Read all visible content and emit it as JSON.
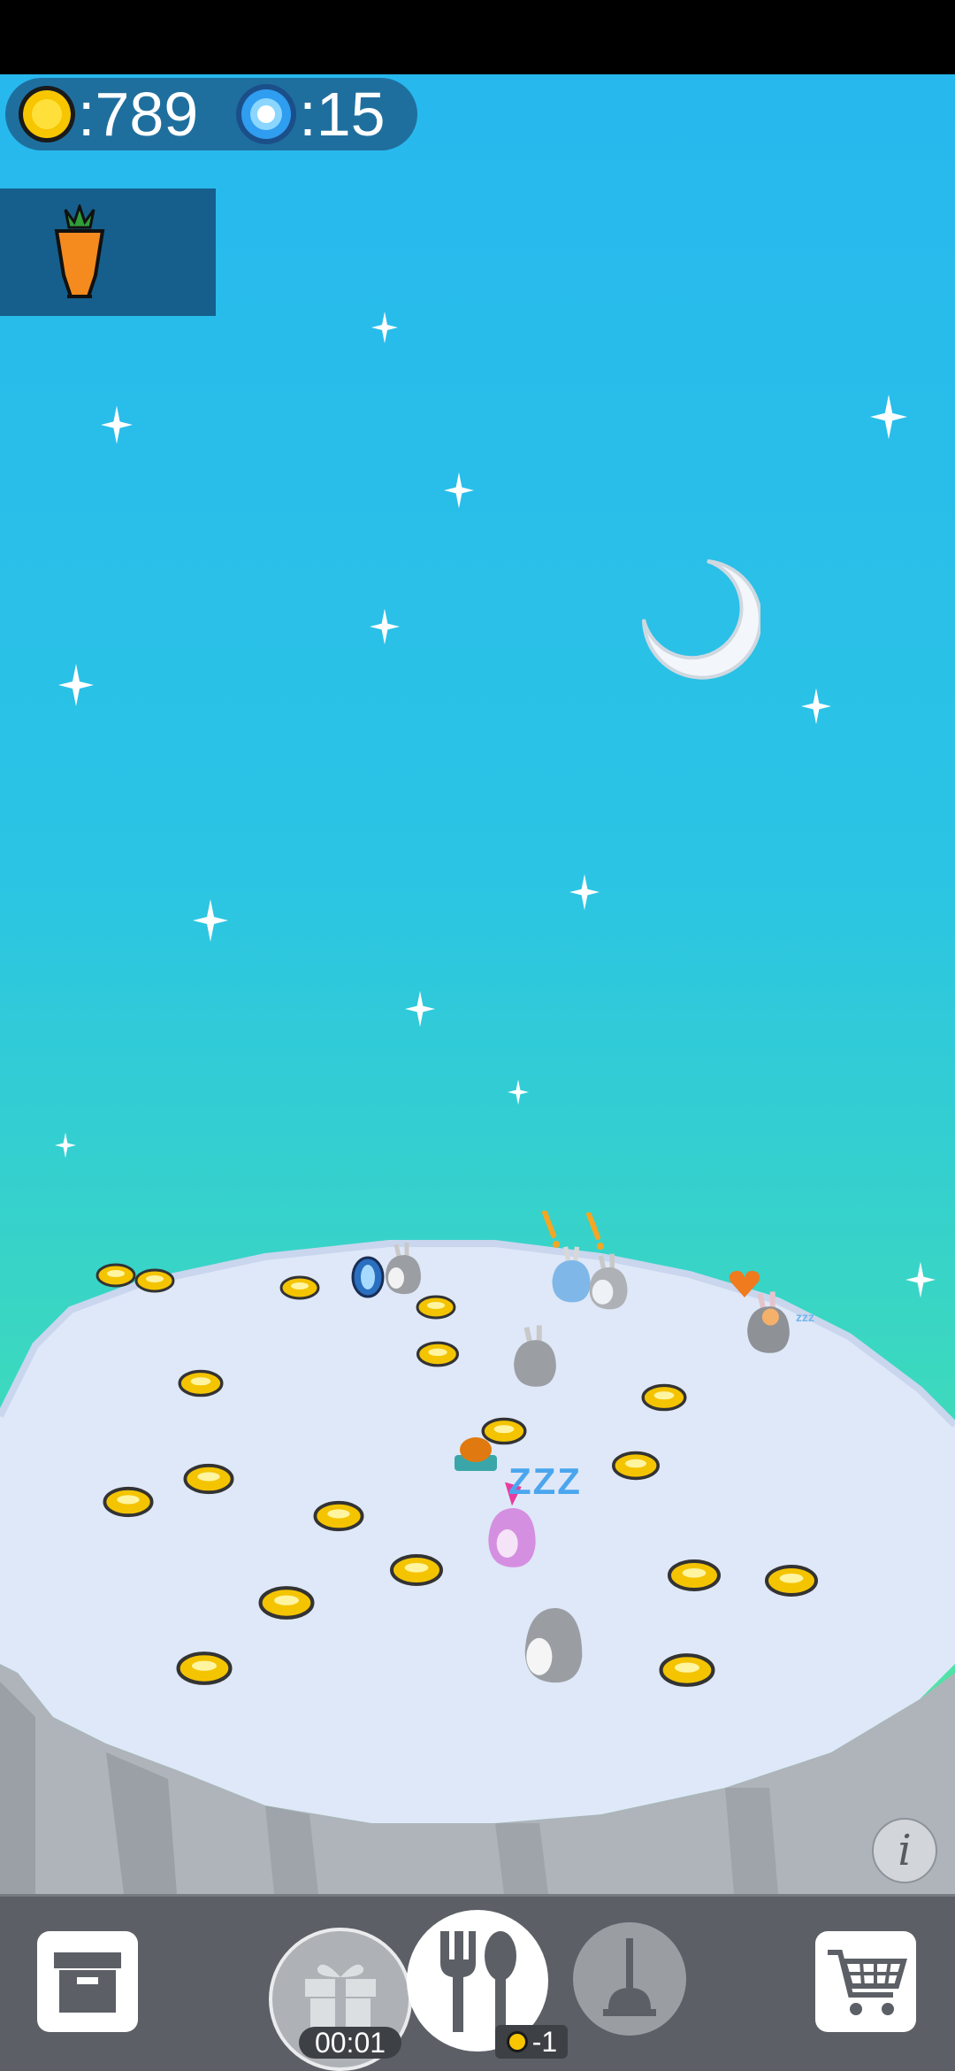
{
  "hud": {
    "coins": ":789",
    "gems": ":15"
  },
  "item_slot": {
    "icon": "carrot-icon"
  },
  "timer": "00:01",
  "feed_cost": "-1",
  "sleep_text": "ZZZ",
  "sleep_text_small": "zzz",
  "info_label": "i",
  "colors": {
    "coin": "#f5c400",
    "gem": "#2d9cf0",
    "hud_bg": "#1f6f9e",
    "toolbar_bg": "#5c6066"
  }
}
